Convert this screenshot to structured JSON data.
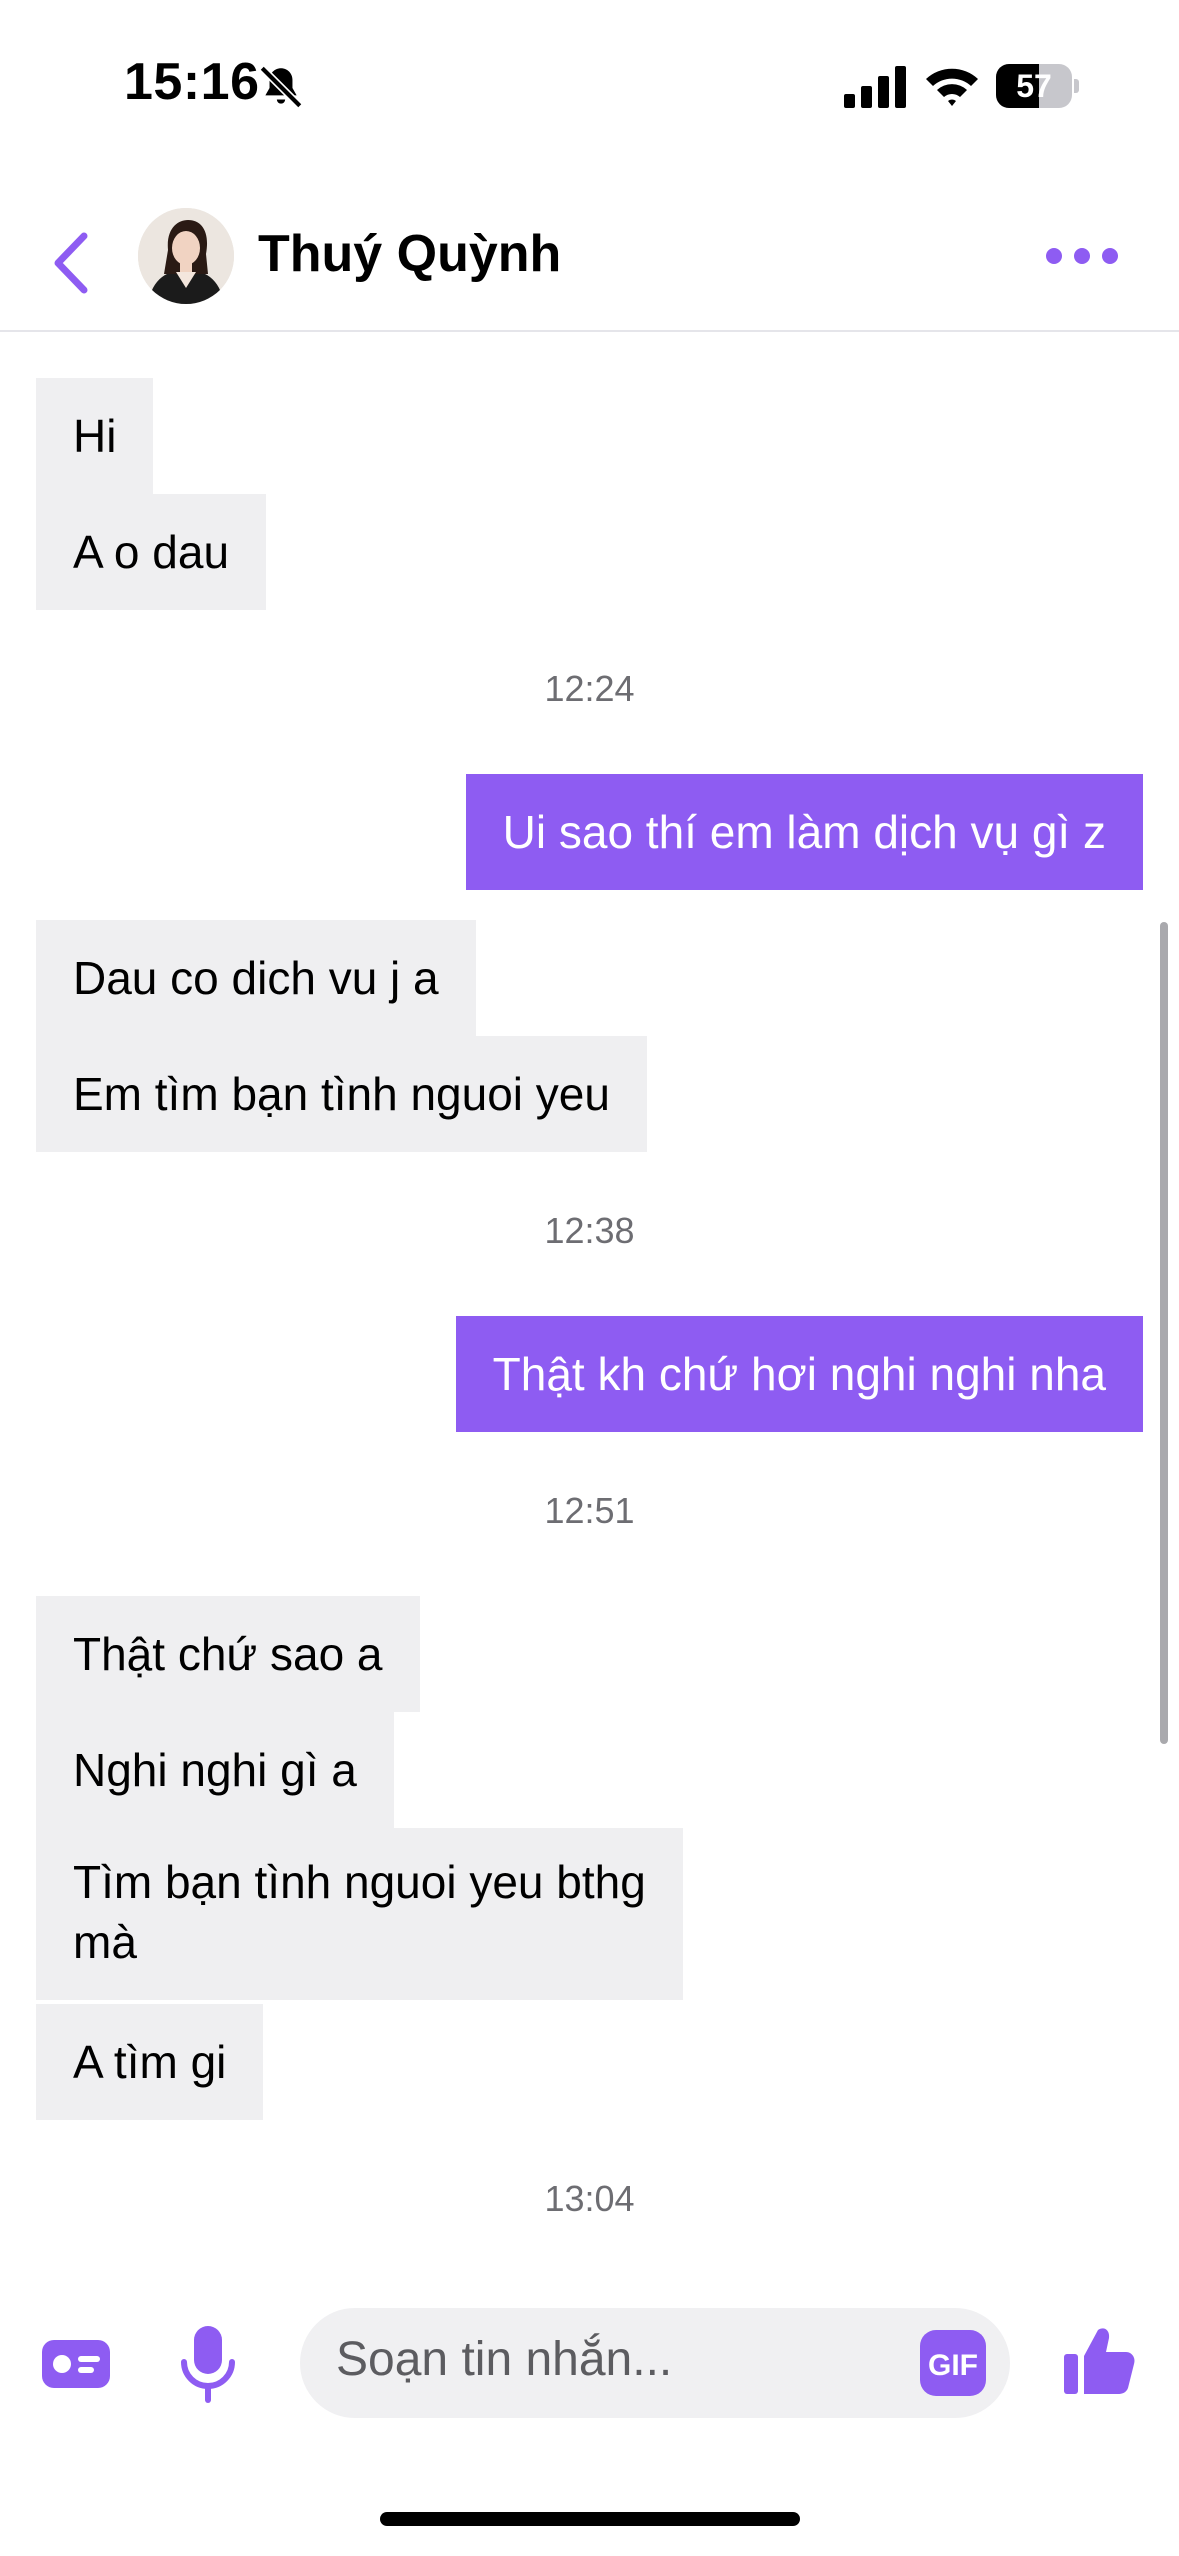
{
  "status_bar": {
    "time": "15:16",
    "battery": "57",
    "battery_level": 0.57
  },
  "header": {
    "contact_name": "Thuý Quỳnh"
  },
  "messages": [
    {
      "kind": "in",
      "text": "Hi"
    },
    {
      "kind": "in",
      "text": "A o dau"
    },
    {
      "kind": "time",
      "text": "12:24"
    },
    {
      "kind": "out",
      "text": "Ui sao thí em làm dịch vụ gì z"
    },
    {
      "kind": "in",
      "text": "Dau co dich vu j a"
    },
    {
      "kind": "in",
      "text": "Em tìm bạn tình nguoi yeu"
    },
    {
      "kind": "time",
      "text": "12:38"
    },
    {
      "kind": "out",
      "text": "Thật kh chứ hơi nghi nghi nha"
    },
    {
      "kind": "time",
      "text": "12:51"
    },
    {
      "kind": "in",
      "text": "Thật chứ sao a"
    },
    {
      "kind": "in",
      "text": "Nghi nghi gì a"
    },
    {
      "kind": "in",
      "text": "Tìm bạn tình nguoi yeu bthg",
      "text2": "mà"
    },
    {
      "kind": "in",
      "text": "A tìm gi"
    },
    {
      "kind": "time",
      "text": "13:04"
    }
  ],
  "composer": {
    "placeholder": "Soạn tin nhắn...",
    "gif_label": "GIF"
  },
  "icons": {
    "back": "chevron-left-icon",
    "more": "more-dots-icon",
    "card": "contact-card-icon",
    "mic": "microphone-icon",
    "gif": "gif-icon",
    "like": "thumbs-up-icon"
  },
  "colors": {
    "accent": "#8e5cf2",
    "incoming_bubble": "#efeff1",
    "timestamp": "#6d6d72"
  }
}
